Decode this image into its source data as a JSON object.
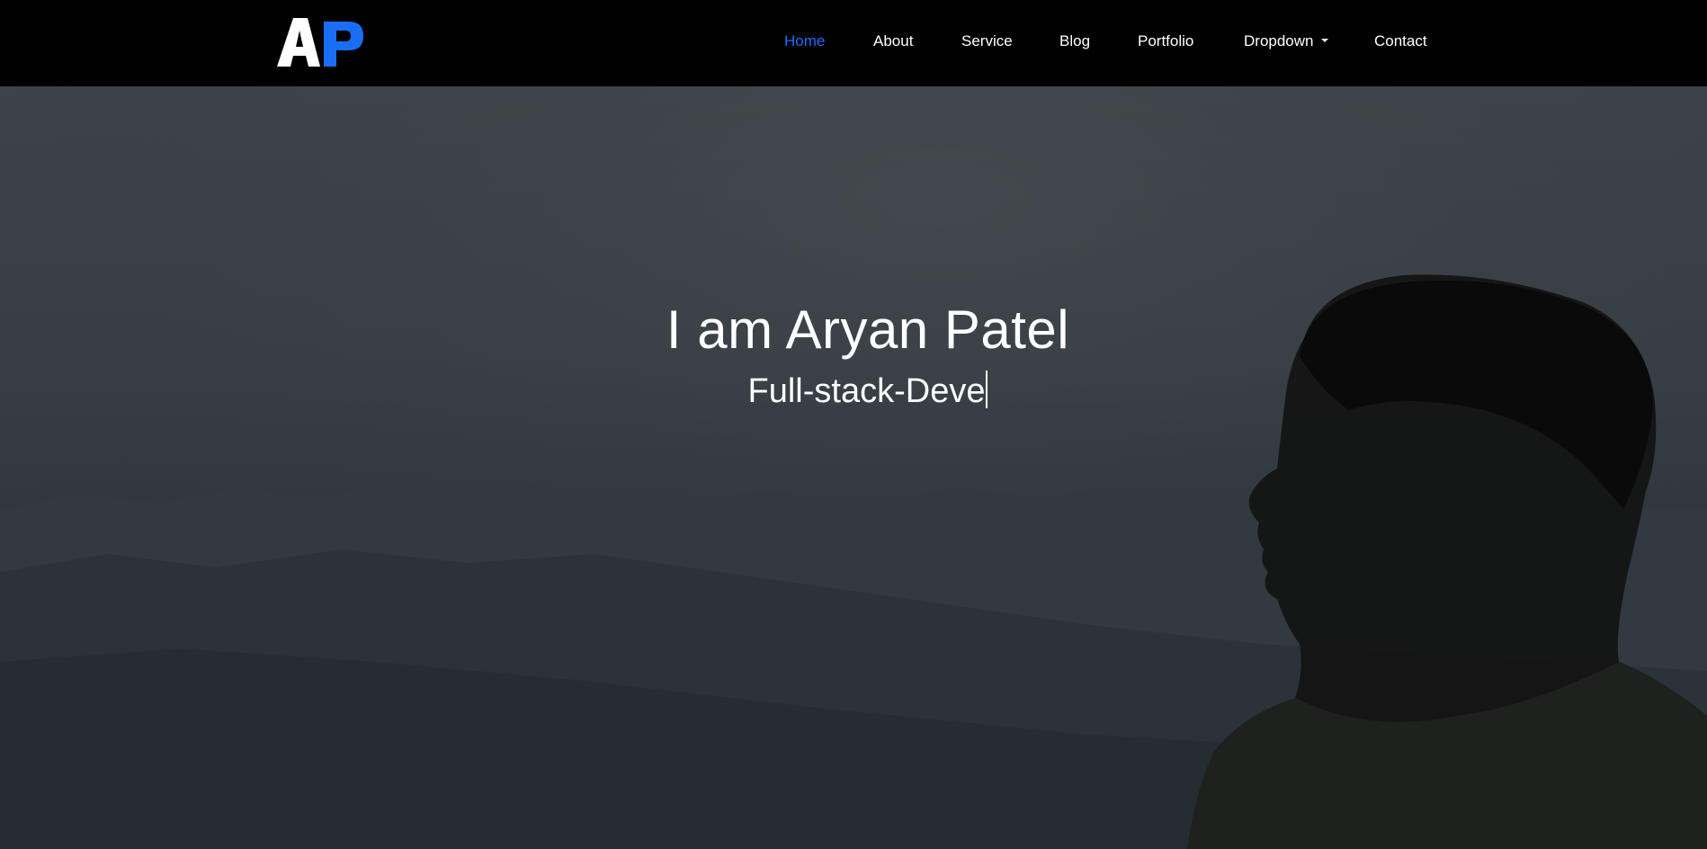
{
  "brand": {
    "logo_text": "AP",
    "colors": {
      "logo_a": "#ffffff",
      "logo_p": "#1a6ef5",
      "active_link": "#1a6ef5",
      "navbar_bg": "#000000"
    }
  },
  "nav": {
    "items": [
      {
        "label": "Home",
        "active": true
      },
      {
        "label": "About",
        "active": false
      },
      {
        "label": "Service",
        "active": false
      },
      {
        "label": "Blog",
        "active": false
      },
      {
        "label": "Portfolio",
        "active": false
      },
      {
        "label": "Dropdown",
        "active": false,
        "icon": "caret-down-icon"
      },
      {
        "label": "Contact",
        "active": false
      }
    ]
  },
  "hero": {
    "title": "I am Aryan Patel",
    "typed_text": "Full-stack-Deve"
  }
}
